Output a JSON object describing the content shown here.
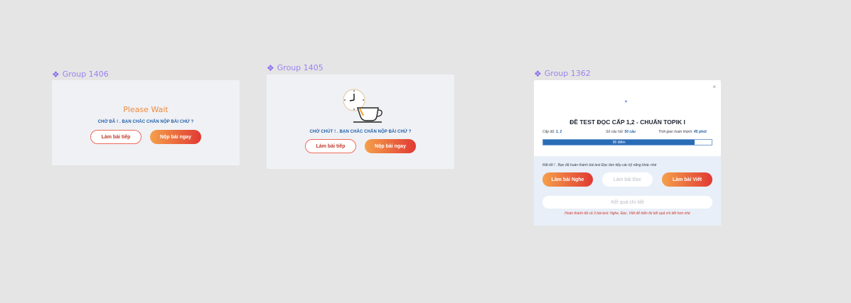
{
  "frames": {
    "group1406": {
      "label": "Group 1406"
    },
    "group1405": {
      "label": "Group 1405"
    },
    "group1362": {
      "label": "Group 1362"
    }
  },
  "panel1": {
    "title": "Please Wait",
    "confirm": "CHỜ ĐÃ ! . BẠN CHẮC CHẮN NỘP BÀI CHỨ ?",
    "continue_label": "Làm bài tiếp",
    "submit_label": "Nộp bài ngay"
  },
  "panel2": {
    "illustration": "clock-coffee-icon",
    "confirm": "CHỜ CHÚT ! . BẠN CHẮC CHẮN NỘP BÀI CHỨ ?",
    "continue_label": "Làm bài tiếp",
    "submit_label": "Nộp bài ngay"
  },
  "panel3": {
    "close": "×",
    "title": "ĐỀ TEST ĐỌC CẤP 1,2 - CHUẨN TOPIK I",
    "level_label": "Cấp độ:",
    "level_value": "1, 2",
    "questions_label": "Số câu hỏi:",
    "questions_value": "50 câu",
    "time_label": "Thời gian hoàn thành:",
    "time_value": "45 phút",
    "score_text": "90 điểm",
    "score_fraction": 0.9,
    "note": "Rất tốt ! . Bạn đã hoàn thành bài test Đọc làm tiếp các kỹ năng khác nhé",
    "listen_label": "Làm bài Nghe",
    "read_label": "Làm bài Đọc",
    "write_label": "Làm bài Viết",
    "detail_label": "Kết quả chi tiết",
    "warning": "Hoàn thành tất cả 3 bài test: Nghe, Đọc, Viết để hiển thị kết quả chi tiết hơn nhé"
  },
  "colors": {
    "accent_orange": "#f5a04a",
    "accent_red": "#e03a33",
    "primary_blue": "#2a6cb5",
    "frame_label": "#9b82f0"
  }
}
